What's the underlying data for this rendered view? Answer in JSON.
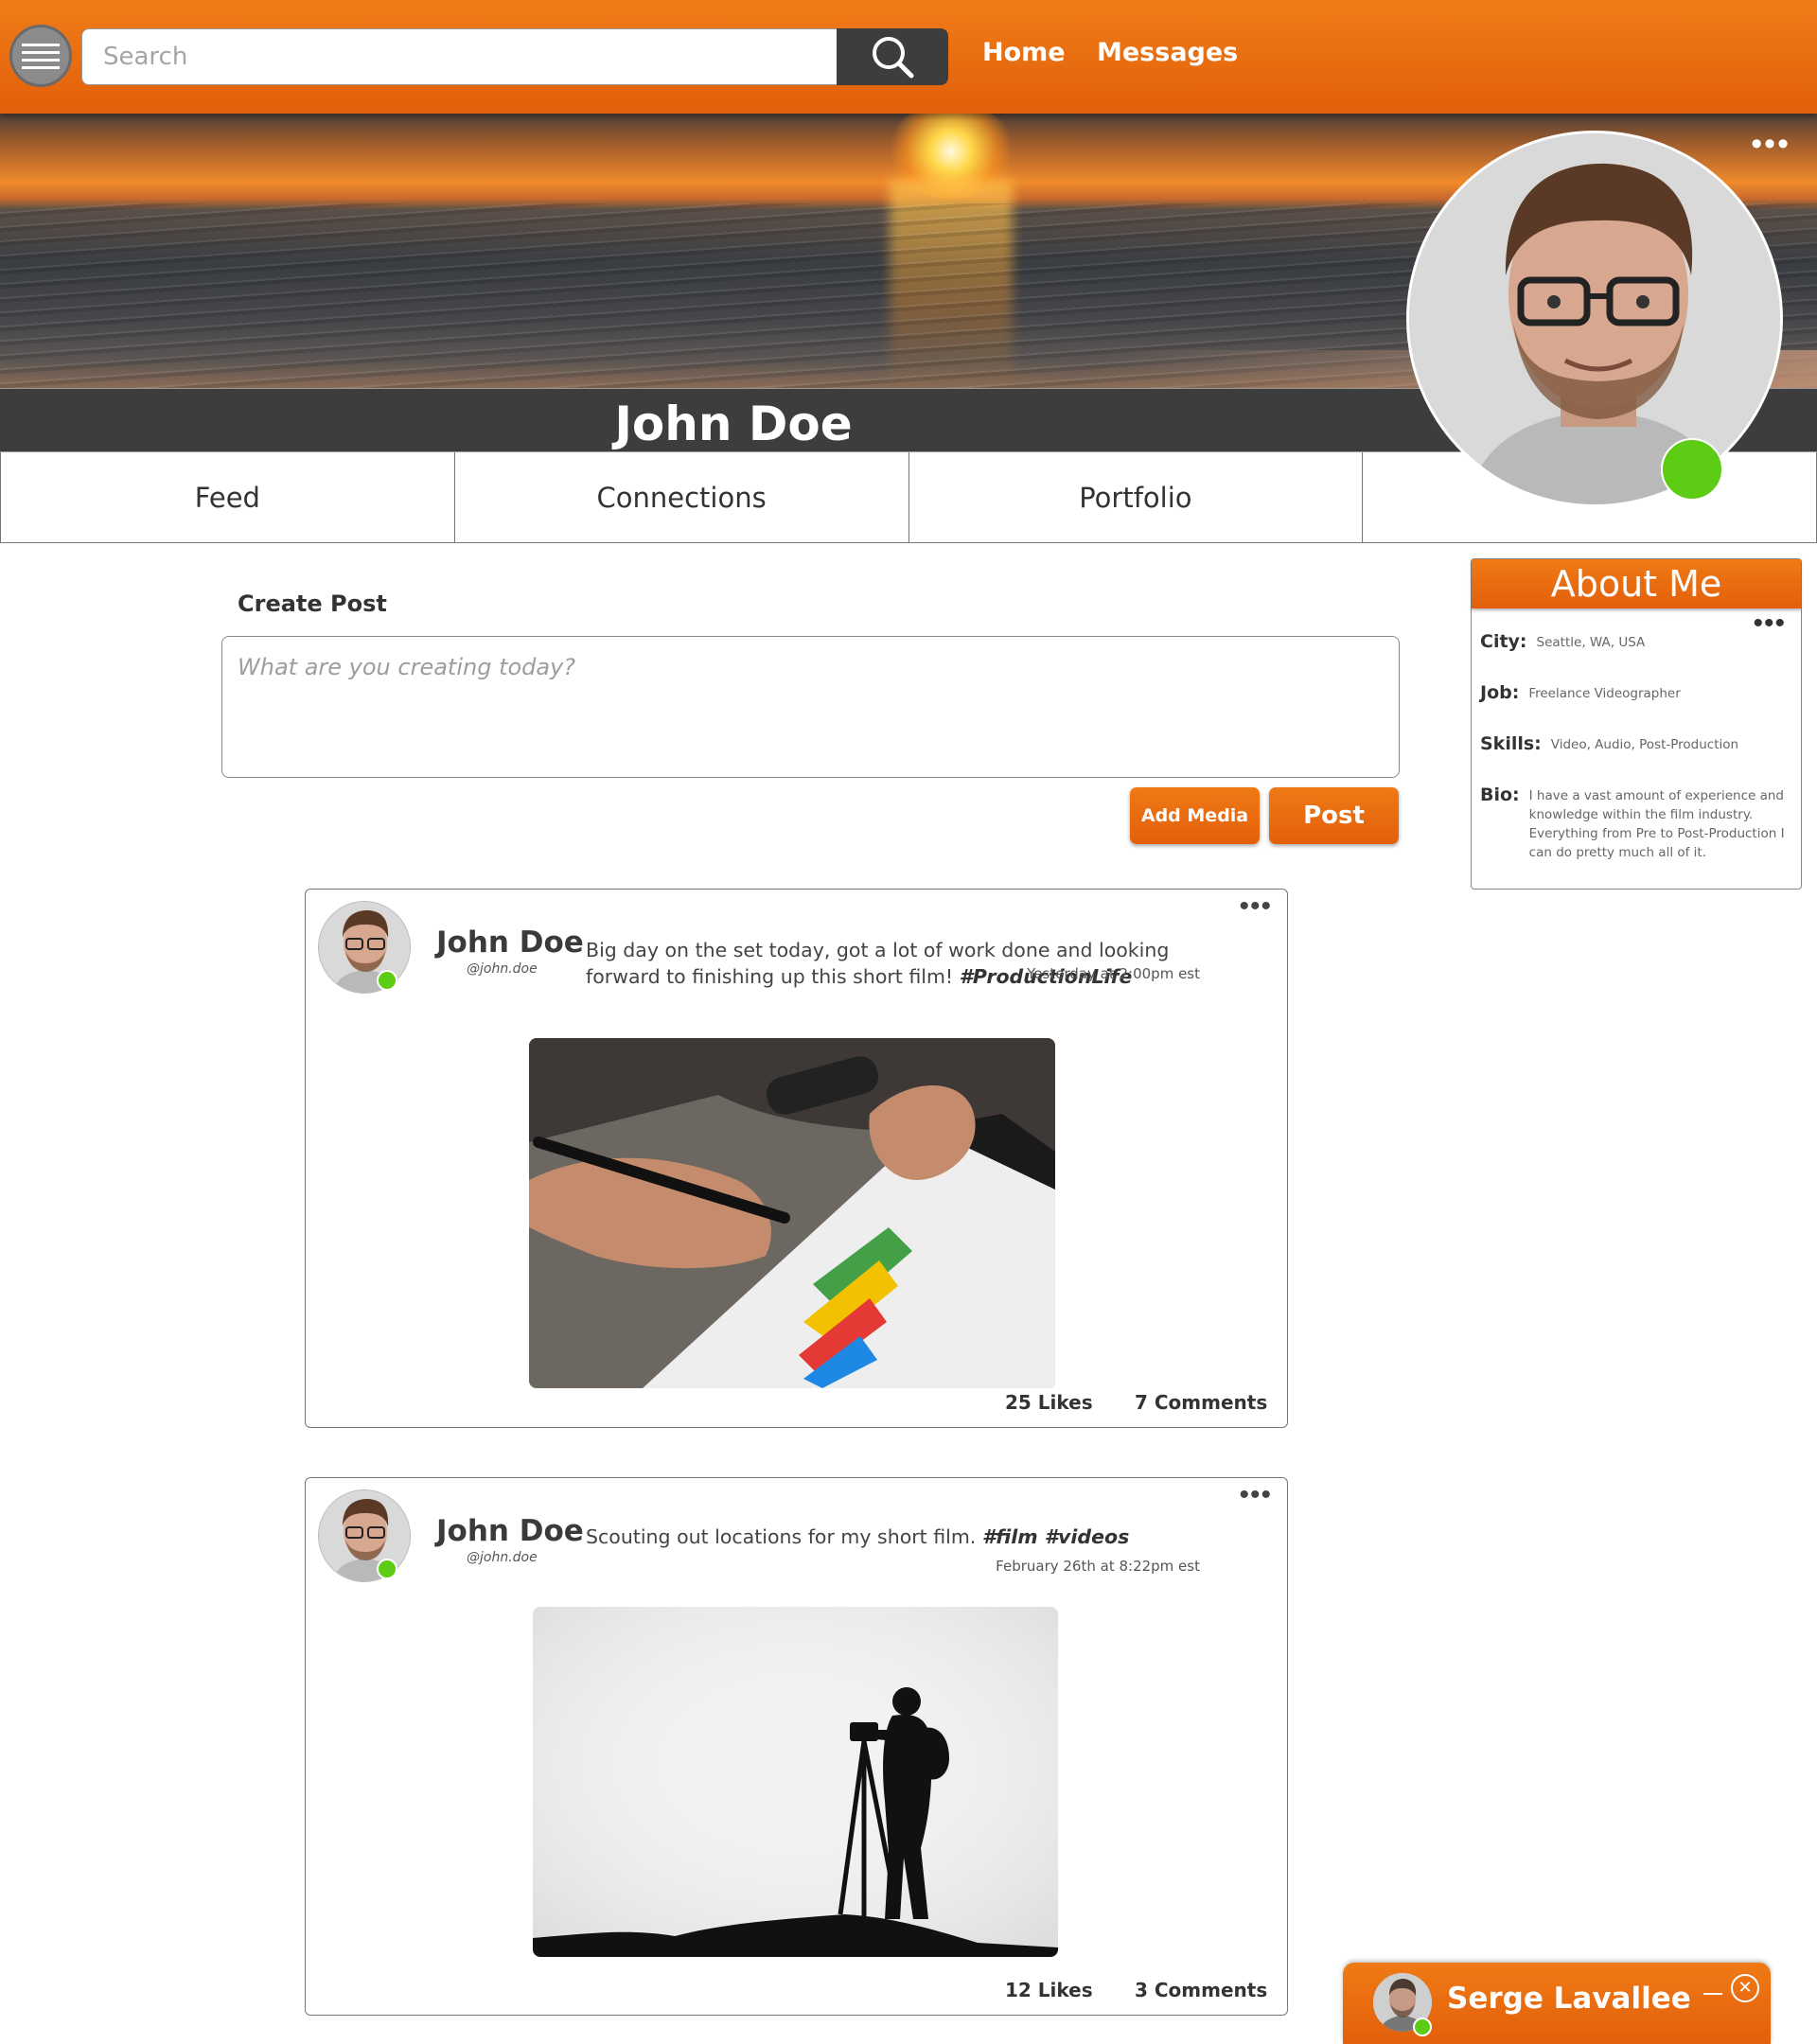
{
  "topbar": {
    "search_placeholder": "Search",
    "nav": [
      "Home",
      "Messages"
    ]
  },
  "profile": {
    "name": "John Doe",
    "tabs": [
      "Feed",
      "Connections",
      "Portfolio",
      ""
    ],
    "online": true
  },
  "create_post": {
    "title": "Create Post",
    "placeholder": "What are you creating today?",
    "add_media_label": "Add Media",
    "post_label": "Post"
  },
  "about": {
    "title": "About Me",
    "rows": [
      {
        "label": "City:",
        "value": "Seattle, WA, USA"
      },
      {
        "label": "Job:",
        "value": "Freelance Videographer"
      },
      {
        "label": "Skills:",
        "value": "Video, Audio, Post-Production"
      },
      {
        "label": "Bio:",
        "value": "I have a vast amount of experience and knowledge within the film industry. Everything from Pre to Post-Production I can do pretty much all of it."
      }
    ]
  },
  "posts": [
    {
      "author": "John Doe",
      "handle": "@john.doe",
      "text": "Big day on the set today, got a lot of work done and looking forward to finishing up this short film!",
      "hashtags": "#ProductionLife",
      "timestamp": "Yesterday at 2:00pm est",
      "likes": "25 Likes",
      "comments": "7 Comments"
    },
    {
      "author": "John Doe",
      "handle": "@john.doe",
      "text": "Scouting out locations for my short film.",
      "hashtags": "#film #videos",
      "timestamp": "February 26th at 8:22pm est",
      "likes": "12 Likes",
      "comments": "3 Comments"
    }
  ],
  "chat": {
    "name": "Serge Lavallee"
  },
  "colors": {
    "accent": "#e8690f",
    "dark": "#3d3d3d",
    "online": "#5ccc14"
  },
  "icons": {
    "menu": "hamburger-icon",
    "search": "search-icon",
    "more": "more-dots-icon",
    "close": "close-icon",
    "minimize": "minimize-icon"
  }
}
